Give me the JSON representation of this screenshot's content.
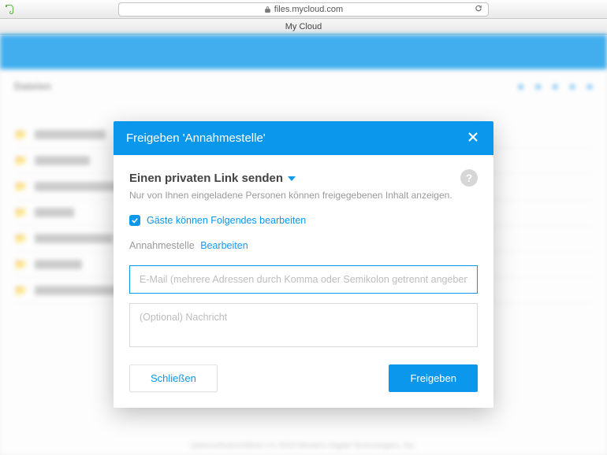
{
  "browser": {
    "url": "files.mycloud.com",
    "tab_title": "My Cloud"
  },
  "background": {
    "breadcrumb": "Dateien",
    "footer": "Datenschutzrichtlinie   |   © 2016 Western Digital Technologies, Inc."
  },
  "modal": {
    "title": "Freigeben 'Annahmestelle'",
    "section_title": "Einen privaten Link senden",
    "section_desc": "Nur von Ihnen eingeladene Personen können freigegebenen Inhalt anzeigen.",
    "checkbox_label": "Gäste können Folgendes bearbeiten",
    "item_name": "Annahmestelle",
    "edit_link": "Bearbeiten",
    "email_placeholder": "E-Mail (mehrere Adressen durch Komma oder Semikolon getrennt angeben)",
    "message_placeholder": "(Optional) Nachricht",
    "close_label": "Schließen",
    "submit_label": "Freigeben"
  }
}
